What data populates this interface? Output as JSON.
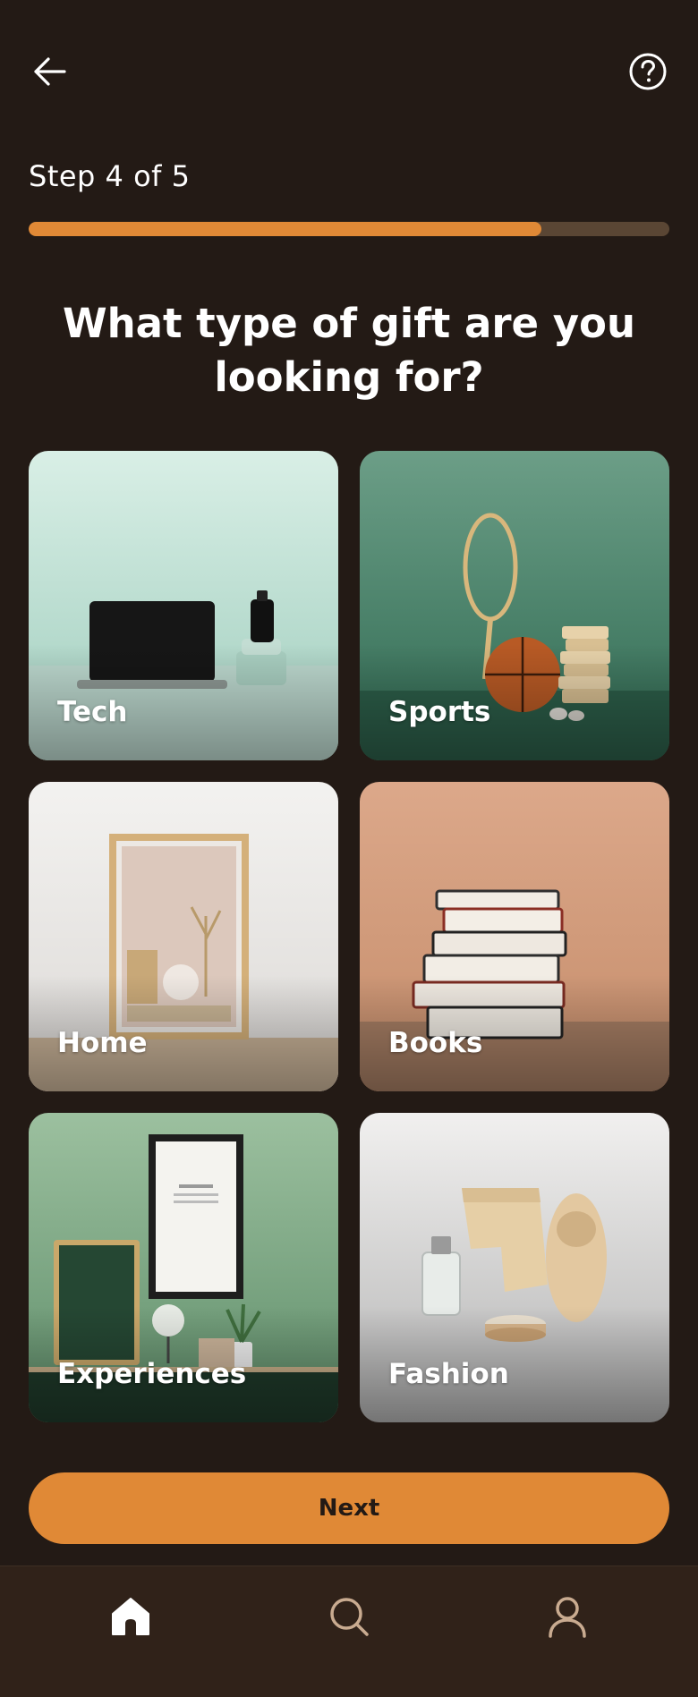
{
  "header": {
    "back_icon": "arrow-left-icon",
    "help_icon": "question-circle-icon"
  },
  "progress": {
    "label": "Step 4 of 5",
    "current": 4,
    "total": 5,
    "fraction": 0.8
  },
  "question": {
    "title": "What type of gift are you looking for?"
  },
  "categories": [
    {
      "label": "Tech"
    },
    {
      "label": "Sports"
    },
    {
      "label": "Home"
    },
    {
      "label": "Books"
    },
    {
      "label": "Experiences"
    },
    {
      "label": "Fashion"
    }
  ],
  "actions": {
    "next_label": "Next"
  },
  "nav": {
    "items": [
      {
        "icon": "home-icon",
        "active": true
      },
      {
        "icon": "search-icon",
        "active": false
      },
      {
        "icon": "profile-icon",
        "active": false
      }
    ]
  },
  "colors": {
    "background": "#231a15",
    "accent": "#e08936",
    "track": "#5a4634",
    "nav_background": "#302219",
    "nav_inactive": "#c9ab90"
  }
}
